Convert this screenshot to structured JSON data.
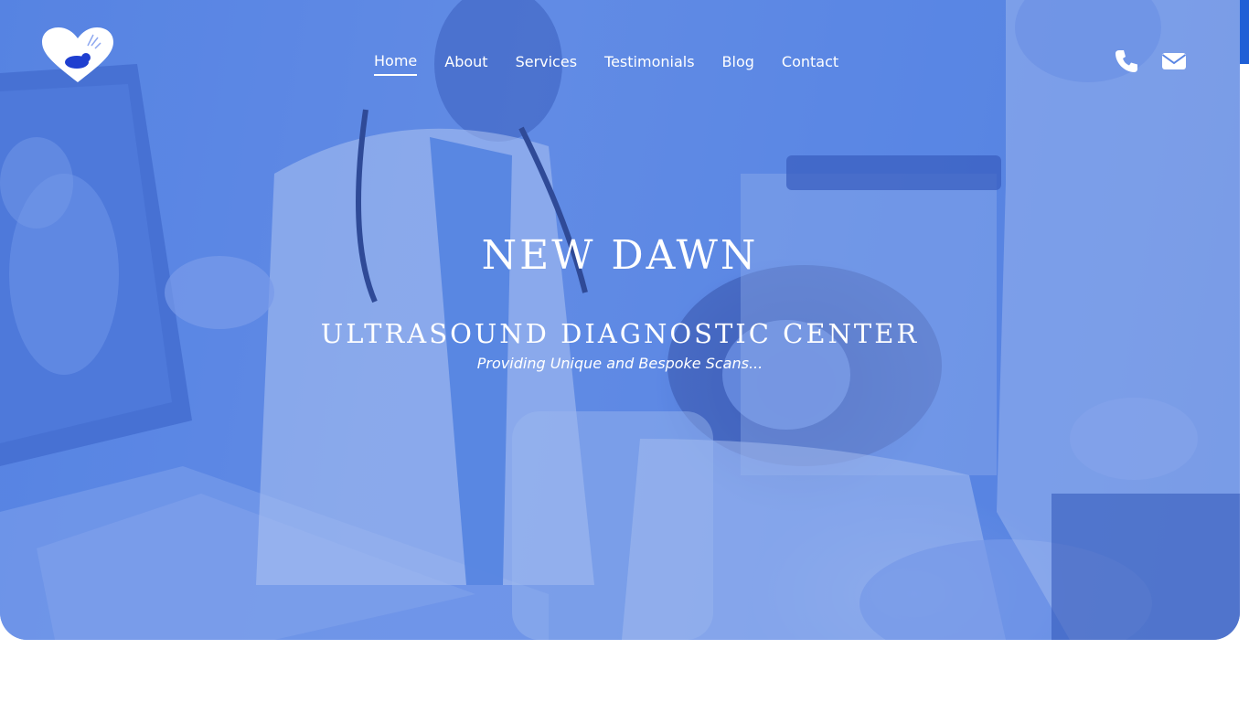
{
  "brand": {
    "logo_icon": "heart-ultrasound-logo",
    "accent_color": "#5a86e4",
    "secondary_accent": "#1f5fd6"
  },
  "nav": {
    "items": [
      {
        "label": "Home",
        "active": true
      },
      {
        "label": "About",
        "active": false
      },
      {
        "label": "Services",
        "active": false
      },
      {
        "label": "Testimonials",
        "active": false
      },
      {
        "label": "Blog",
        "active": false
      },
      {
        "label": "Contact",
        "active": false
      }
    ]
  },
  "header_icons": {
    "phone": "phone-icon",
    "email": "envelope-icon"
  },
  "hero": {
    "title": "NEW DAWN",
    "subtitle": "ULTRASOUND DIAGNOSTIC CENTER",
    "tagline": "Providing Unique and Bespoke Scans..."
  }
}
